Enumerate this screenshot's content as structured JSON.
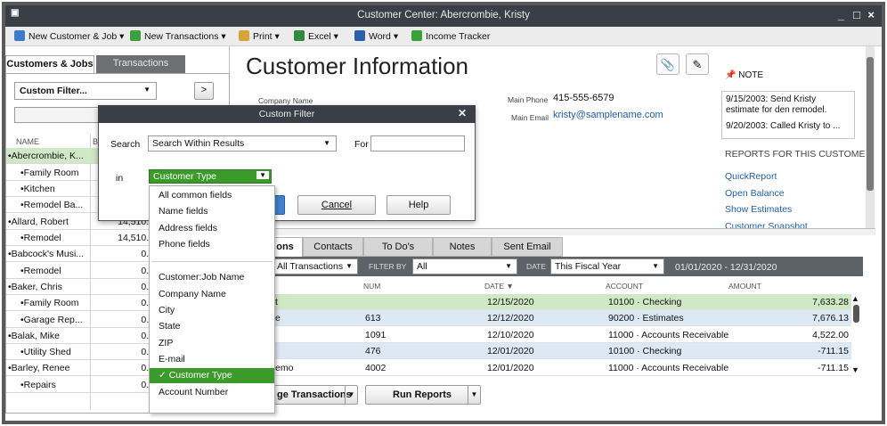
{
  "window": {
    "title": "Customer Center: Abercrombie, Kristy",
    "controls": [
      "_",
      "□",
      "×"
    ]
  },
  "toolbar": {
    "new_customer_job": "New Customer & Job",
    "new_transactions": "New Transactions",
    "print": "Print",
    "excel": "Excel",
    "word": "Word",
    "income_tracker": "Income Tracker"
  },
  "left": {
    "tab_customers": "Customers & Jobs",
    "tab_transactions": "Transactions",
    "filter_value": "Custom Filter...",
    "col_name": "NAME",
    "col_balance": "B",
    "rows": [
      {
        "name": "•Abercrombie, K...",
        "balance": ""
      },
      {
        "name": "•Family Room",
        "balance": ""
      },
      {
        "name": "•Kitchen",
        "balance": ""
      },
      {
        "name": "•Remodel Ba...",
        "balance": ""
      },
      {
        "name": "•Allard, Robert",
        "balance": "14,510.0"
      },
      {
        "name": "•Remodel",
        "balance": "14,510.0"
      },
      {
        "name": "•Babcock's Musi...",
        "balance": "0.0"
      },
      {
        "name": "•Remodel",
        "balance": "0.0"
      },
      {
        "name": "•Baker, Chris",
        "balance": "0.0"
      },
      {
        "name": "•Family Room",
        "balance": "0.0"
      },
      {
        "name": "•Garage Rep...",
        "balance": "0.0"
      },
      {
        "name": "•Balak, Mike",
        "balance": "0.0"
      },
      {
        "name": "•Utility Shed",
        "balance": "0.0"
      },
      {
        "name": "•Barley, Renee",
        "balance": "0.0"
      },
      {
        "name": "•Repairs",
        "balance": "0.0"
      }
    ]
  },
  "info": {
    "title": "Customer Information",
    "company_name_label": "Company Name",
    "main_phone_label": "Main Phone",
    "main_phone": "415-555-6579",
    "main_email_label": "Main Email",
    "main_email": "kristy@samplename.com"
  },
  "note": {
    "title": "NOTE",
    "line1": "9/15/2003:  Send Kristy estimate for den remodel.",
    "line2": "9/20/2003:  Called Kristy to ..."
  },
  "reports": {
    "title": "REPORTS FOR THIS CUSTOMER",
    "links": [
      "QuickReport",
      "Open Balance",
      "Show Estimates",
      "Customer Snapshot"
    ]
  },
  "tabs2": [
    "ons",
    "Contacts",
    "To Do's",
    "Notes",
    "Sent Email"
  ],
  "filterbar": {
    "show_value": "All Transactions",
    "filter_by_label": "FILTER BY",
    "filter_by_value": "All",
    "date_label": "DATE",
    "date_value": "This Fiscal Year",
    "date_range": "01/01/2020 - 12/31/2020"
  },
  "table": {
    "headers": {
      "num": "NUM",
      "date": "DATE ▼",
      "account": "ACCOUNT",
      "amount": "AMOUNT"
    },
    "rows": [
      {
        "type": "t",
        "num": "",
        "date": "12/15/2020",
        "account": "10100 · Checking",
        "amount": "7,633.28"
      },
      {
        "type": "e",
        "num": "613",
        "date": "12/12/2020",
        "account": "90200 · Estimates",
        "amount": "7,676.13"
      },
      {
        "type": "",
        "num": "1091",
        "date": "12/10/2020",
        "account": "11000 · Accounts Receivable",
        "amount": "4,522.00"
      },
      {
        "type": "",
        "num": "476",
        "date": "12/01/2020",
        "account": "10100 · Checking",
        "amount": "-711.15"
      },
      {
        "type": "emo",
        "num": "4002",
        "date": "12/01/2020",
        "account": "11000 · Accounts Receivable",
        "amount": "-711.15"
      }
    ]
  },
  "bottom": {
    "manage": "ge Transactions",
    "reports": "Run Reports"
  },
  "dialog": {
    "title": "Custom Filter",
    "search_label": "Search",
    "search_value": "Search Within Results",
    "for_label": "For",
    "for_value": "",
    "in_label": "in",
    "in_value": "Customer Type",
    "cancel": "Cancel",
    "help": "Help"
  },
  "dropdown": {
    "group1": [
      "All common fields",
      "Name fields",
      "Address fields",
      "Phone fields"
    ],
    "group2": [
      "Customer:Job Name",
      "Company Name",
      "City",
      "State",
      "ZIP",
      "E-mail",
      "Customer Type",
      "Account Number"
    ],
    "selected": "Customer Type"
  },
  "colors": {
    "titlebar": "#3a3f47",
    "selected_green": "#3a9a2a",
    "row_green": "#cfe8c6",
    "row_blue": "#dde8f5",
    "link": "#1c5fb0"
  }
}
